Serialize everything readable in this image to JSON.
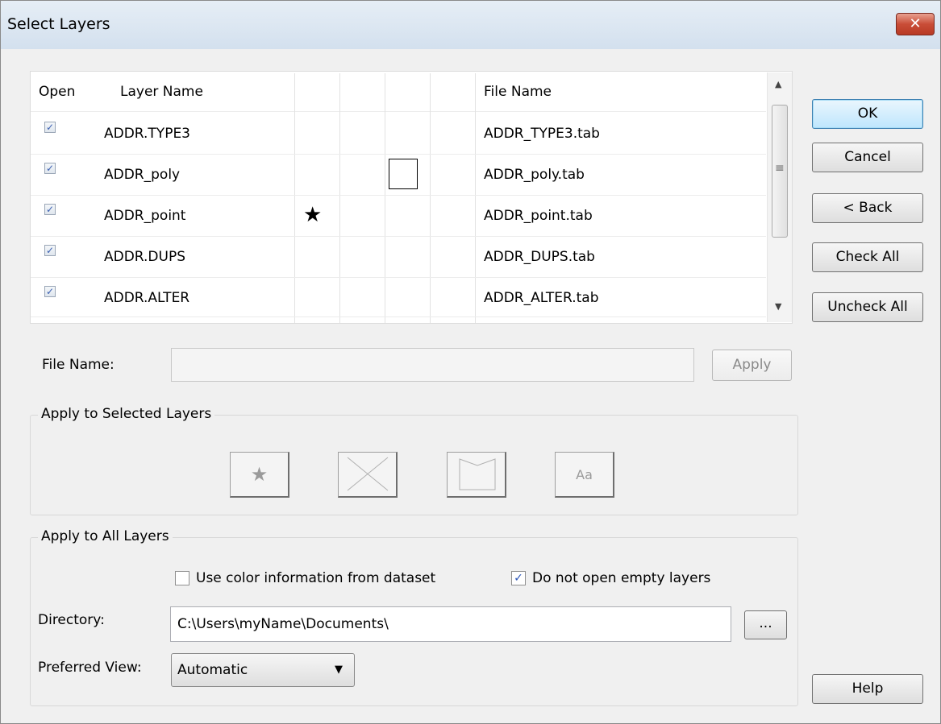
{
  "window": {
    "title": "Select Layers",
    "close_glyph": "✕"
  },
  "grid": {
    "columns": {
      "open": "Open",
      "layer_name": "Layer Name",
      "file_name": "File Name"
    },
    "rows": [
      {
        "checked": true,
        "layer_name": "ADDR.TYPE3",
        "file_name": "ADDR_TYPE3.tab",
        "symbol": ""
      },
      {
        "checked": true,
        "layer_name": "ADDR_poly",
        "file_name": "ADDR_poly.tab",
        "symbol": "region"
      },
      {
        "checked": true,
        "layer_name": "ADDR_point",
        "file_name": "ADDR_point.tab",
        "symbol": "★"
      },
      {
        "checked": true,
        "layer_name": "ADDR.DUPS",
        "file_name": "ADDR_DUPS.tab",
        "symbol": ""
      },
      {
        "checked": true,
        "layer_name": "ADDR.ALTER",
        "file_name": "ADDR_ALTER.tab",
        "symbol": ""
      }
    ],
    "check_glyph": "✓"
  },
  "buttons": {
    "ok": "OK",
    "cancel": "Cancel",
    "back": "< Back",
    "check_all": "Check All",
    "uncheck_all": "Uncheck All",
    "apply": "Apply",
    "browse": "...",
    "help": "Help"
  },
  "file_name": {
    "label": "File Name:",
    "value": ""
  },
  "apply_selected": {
    "legend": "Apply to Selected Layers",
    "star": "★",
    "text_style": "Aa"
  },
  "apply_all": {
    "legend": "Apply to All Layers",
    "use_color_label": "Use color information from dataset",
    "use_color_checked": false,
    "no_empty_label": "Do not open empty layers",
    "no_empty_checked": true,
    "directory_label": "Directory:",
    "directory_value": "C:\\Users\\myName\\Documents\\",
    "preferred_view_label": "Preferred View:",
    "preferred_view_value": "Automatic"
  },
  "icons": {
    "check": "✓",
    "dropdown": "▼",
    "scroll_up": "▲",
    "scroll_down": "▼",
    "grip": "≡"
  }
}
